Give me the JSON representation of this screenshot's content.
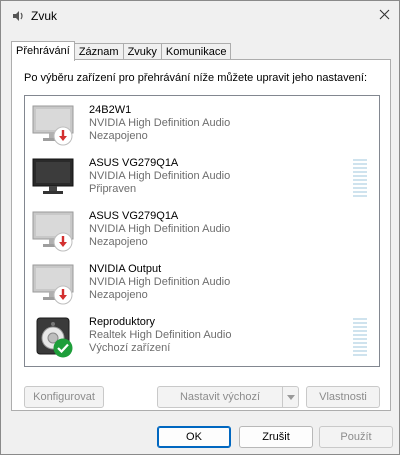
{
  "window": {
    "title": "Zvuk",
    "icons": {
      "app": "speaker-icon",
      "close": "close-icon"
    }
  },
  "tabs": [
    {
      "label": "Přehrávání",
      "active": true
    },
    {
      "label": "Záznam",
      "active": false
    },
    {
      "label": "Zvuky",
      "active": false
    },
    {
      "label": "Komunikace",
      "active": false
    }
  ],
  "instruction": "Po výběru zařízení pro přehrávání níže můžete upravit jeho nastavení:",
  "devices": [
    {
      "name": "24B2W1",
      "driver": "NVIDIA High Definition Audio",
      "state": "Nezapojeno",
      "icon": "monitor-icon",
      "badge": "unplugged-icon",
      "level_meter": false
    },
    {
      "name": "ASUS VG279Q1A",
      "driver": "NVIDIA High Definition Audio",
      "state": "Připraven",
      "icon": "monitor-icon",
      "badge": "",
      "level_meter": true
    },
    {
      "name": "ASUS VG279Q1A",
      "driver": "NVIDIA High Definition Audio",
      "state": "Nezapojeno",
      "icon": "monitor-icon",
      "badge": "unplugged-icon",
      "level_meter": false
    },
    {
      "name": "NVIDIA Output",
      "driver": "NVIDIA High Definition Audio",
      "state": "Nezapojeno",
      "icon": "monitor-icon",
      "badge": "unplugged-icon",
      "level_meter": false
    },
    {
      "name": "Reproduktory",
      "driver": "Realtek High Definition Audio",
      "state": "Výchozí zařízení",
      "icon": "speaker-icon",
      "badge": "default-check-icon",
      "level_meter": true
    }
  ],
  "buttons": {
    "configure": "Konfigurovat",
    "set_default": "Nastavit výchozí",
    "properties": "Vlastnosti",
    "ok": "OK",
    "cancel": "Zrušit",
    "apply": "Použít"
  },
  "colors": {
    "unplugged_badge": "#d32f2f",
    "default_badge": "#1e9e3a",
    "level_meter": "#cfe3ee",
    "accent": "#0067c0"
  }
}
